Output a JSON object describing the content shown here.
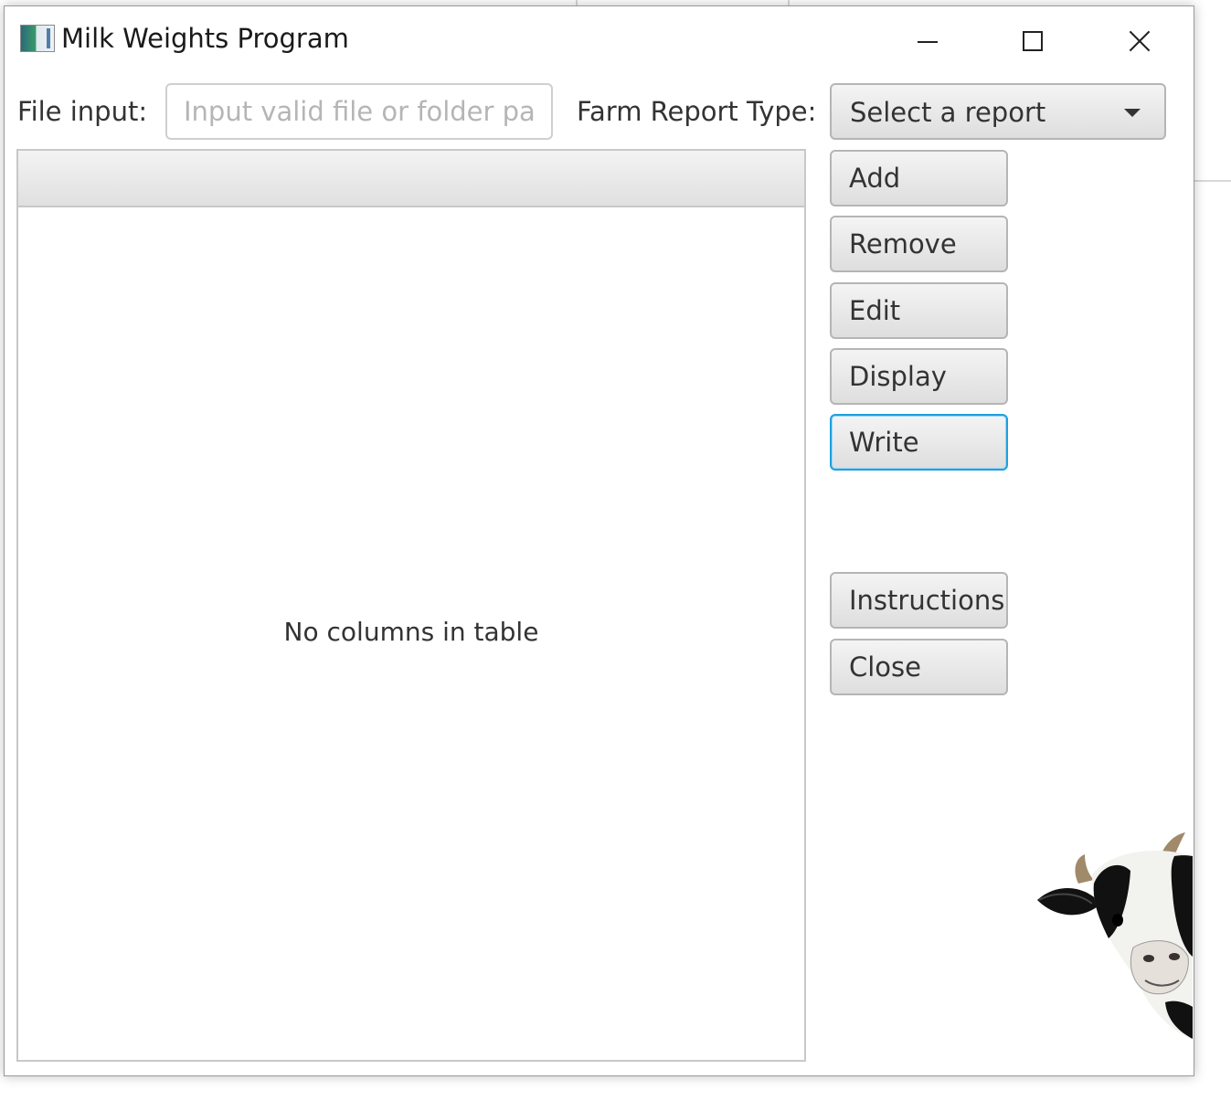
{
  "window": {
    "title": "Milk Weights Program",
    "controls": {
      "minimize_icon": "minimize-icon",
      "maximize_icon": "maximize-icon",
      "close_icon": "close-icon"
    }
  },
  "file_input": {
    "label": "File input:",
    "value": "",
    "placeholder": "Input valid file or folder path"
  },
  "report": {
    "label": "Farm Report Type:",
    "selected": "Select a report"
  },
  "table": {
    "placeholder": "No columns in table"
  },
  "buttons": {
    "add": "Add",
    "remove": "Remove",
    "edit": "Edit",
    "display": "Display",
    "write": "Write",
    "instructions": "Instructions",
    "close": "Close"
  },
  "focused_button": "write",
  "colors": {
    "focus_ring": "#1ea0e0",
    "button_top": "#f4f4f4",
    "button_bottom": "#dedede",
    "border": "#b5b5b5"
  },
  "decoration": {
    "cow_image": "cow-image"
  }
}
